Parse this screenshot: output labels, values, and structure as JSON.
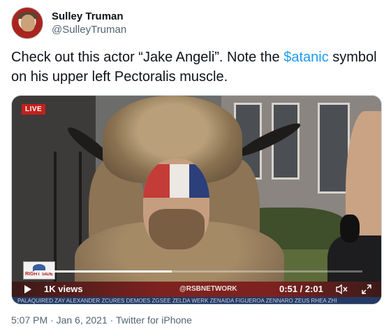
{
  "header": {
    "display_name": "Sulley Truman",
    "handle": "@SulleyTruman"
  },
  "tweet": {
    "text_before": "Check out this actor “Jake Angeli”.  Note the ",
    "hashtag": "$atanic",
    "text_after": " symbol on his upper left Pectoralis muscle."
  },
  "video": {
    "live_label": "LIVE",
    "channel_logo_text": "RIGHT SIDE",
    "views": "1K views",
    "network": "@RSBNETWORK",
    "time": "0:51 / 2:01",
    "progress": 0.42,
    "ticker": "PALAQUIRED  ZAY ALEXANDER  ZCURES DEMOES  ZGSEE  ZELDA WERK  ZENAIDA FIGUEROA  ZENNARO  ZEUS RHEA  ZHI",
    "icons": {
      "play": "play-icon",
      "mute": "mute-icon",
      "fullscreen": "expand-icon"
    }
  },
  "meta": {
    "timestamp": "5:07 PM · Jan 6, 2021 · Twitter for iPhone"
  },
  "colors": {
    "link": "#1d9bf0",
    "secondary_text": "#536471",
    "live_red": "#c4201b"
  }
}
